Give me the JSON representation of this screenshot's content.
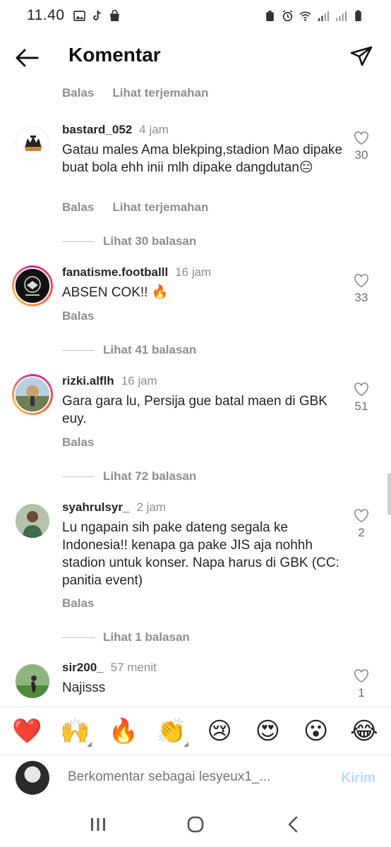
{
  "status": {
    "time": "11.40"
  },
  "header": {
    "title": "Komentar"
  },
  "top_actions": {
    "reply": "Balas",
    "translate": "Lihat terjemahan"
  },
  "comments": [
    {
      "username": "bastard_052",
      "time": "4 jam",
      "text": "Gatau males Ama blekping,stadion Mao dipake buat bola ehh inii mlh dipake dangdutan😑",
      "likes": "30",
      "reply": "Balas",
      "translate": "Lihat terjemahan",
      "view_replies": "Lihat 30 balasan"
    },
    {
      "username": "fanatisme.footballl",
      "time": "16 jam",
      "text": "ABSEN COK!! 🔥",
      "likes": "33",
      "reply": "Balas",
      "view_replies": "Lihat 41 balasan"
    },
    {
      "username": "rizki.alflh",
      "time": "16 jam",
      "text": "Gara gara lu, Persija gue batal maen di GBK euy.",
      "likes": "51",
      "reply": "Balas",
      "view_replies": "Lihat 72 balasan"
    },
    {
      "username": "syahrulsyr_",
      "time": "2 jam",
      "text": "Lu ngapain sih pake dateng segala ke Indonesia!! kenapa ga pake JIS aja nohhh stadion untuk konser. Napa harus di GBK (CC: panitia event)",
      "likes": "2",
      "reply": "Balas",
      "view_replies": "Lihat 1 balasan"
    },
    {
      "username": "sir200_",
      "time": "57 menit",
      "text": "Najisss",
      "likes": "1"
    }
  ],
  "emoji_bar": [
    "❤️",
    "🙌",
    "🔥",
    "👏",
    "😢",
    "😍",
    "😮",
    "😂"
  ],
  "composer": {
    "placeholder": "Berkomentar sebagai lesyeux1_...",
    "send": "Kirim"
  },
  "icons": [
    "back-arrow-icon",
    "send-direct-icon",
    "heart-outline-icon",
    "recents-icon",
    "home-icon",
    "back-icon"
  ],
  "colors": {
    "accent_send_disabled": "#b3dbff",
    "muted_text": "#8e8e8e"
  }
}
